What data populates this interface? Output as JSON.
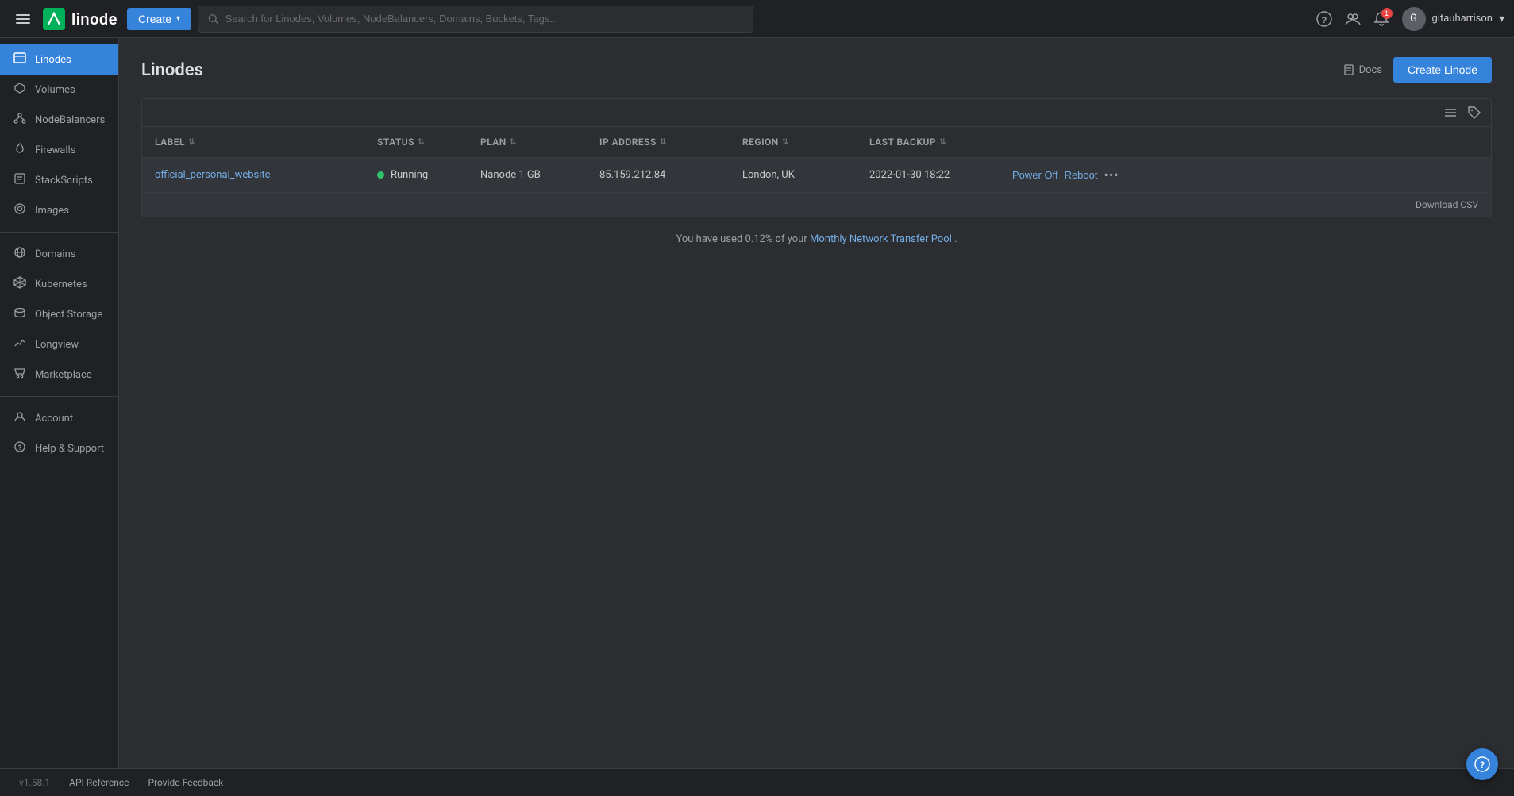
{
  "app": {
    "logo_text": "linode",
    "create_label": "Create",
    "search_placeholder": "Search for Linodes, Volumes, NodeBalancers, Domains, Buckets, Tags...",
    "username": "gitauharrison"
  },
  "sidebar": {
    "items": [
      {
        "id": "linodes",
        "label": "Linodes",
        "icon": "☰",
        "active": true
      },
      {
        "id": "volumes",
        "label": "Volumes",
        "icon": "⬡"
      },
      {
        "id": "nodebalancers",
        "label": "NodeBalancers",
        "icon": "⚖"
      },
      {
        "id": "firewalls",
        "label": "Firewalls",
        "icon": "🔥"
      },
      {
        "id": "stackscripts",
        "label": "StackScripts",
        "icon": "📄"
      },
      {
        "id": "images",
        "label": "Images",
        "icon": "💿"
      },
      {
        "id": "domains",
        "label": "Domains",
        "icon": "🌐"
      },
      {
        "id": "kubernetes",
        "label": "Kubernetes",
        "icon": "⚙"
      },
      {
        "id": "object-storage",
        "label": "Object Storage",
        "icon": "🗄"
      },
      {
        "id": "longview",
        "label": "Longview",
        "icon": "📈"
      },
      {
        "id": "marketplace",
        "label": "Marketplace",
        "icon": "🛒"
      },
      {
        "id": "account",
        "label": "Account",
        "icon": "👤"
      },
      {
        "id": "help-support",
        "label": "Help & Support",
        "icon": "❓"
      }
    ]
  },
  "main": {
    "page_title": "Linodes",
    "docs_label": "Docs",
    "create_linode_label": "Create Linode",
    "download_csv_label": "Download CSV",
    "table": {
      "columns": [
        {
          "id": "label",
          "label": "Label",
          "sortable": true
        },
        {
          "id": "status",
          "label": "Status",
          "sortable": true
        },
        {
          "id": "plan",
          "label": "Plan",
          "sortable": true
        },
        {
          "id": "ip_address",
          "label": "IP Address",
          "sortable": true
        },
        {
          "id": "region",
          "label": "Region",
          "sortable": true
        },
        {
          "id": "last_backup",
          "label": "Last Backup",
          "sortable": true
        },
        {
          "id": "actions",
          "label": "",
          "sortable": false
        }
      ],
      "rows": [
        {
          "label": "official_personal_website",
          "status": "Running",
          "status_color": "#2ec26a",
          "plan": "Nanode 1 GB",
          "ip_address": "85.159.212.84",
          "region": "London, UK",
          "last_backup": "2022-01-30 18:22",
          "actions": [
            "Power Off",
            "Reboot",
            "..."
          ]
        }
      ]
    },
    "network_transfer_text": "You have used 0.12% of your",
    "network_transfer_link": "Monthly Network Transfer Pool",
    "network_transfer_end": "."
  },
  "footer": {
    "version": "v1.58.1",
    "api_reference_label": "API Reference",
    "provide_feedback_label": "Provide Feedback"
  },
  "icons": {
    "hamburger": "☰",
    "search": "🔍",
    "help": "?",
    "team": "👥",
    "bell": "🔔",
    "chevron_down": "▾",
    "docs_file": "📄",
    "list_view": "☰",
    "tag": "🏷",
    "question": "?"
  }
}
